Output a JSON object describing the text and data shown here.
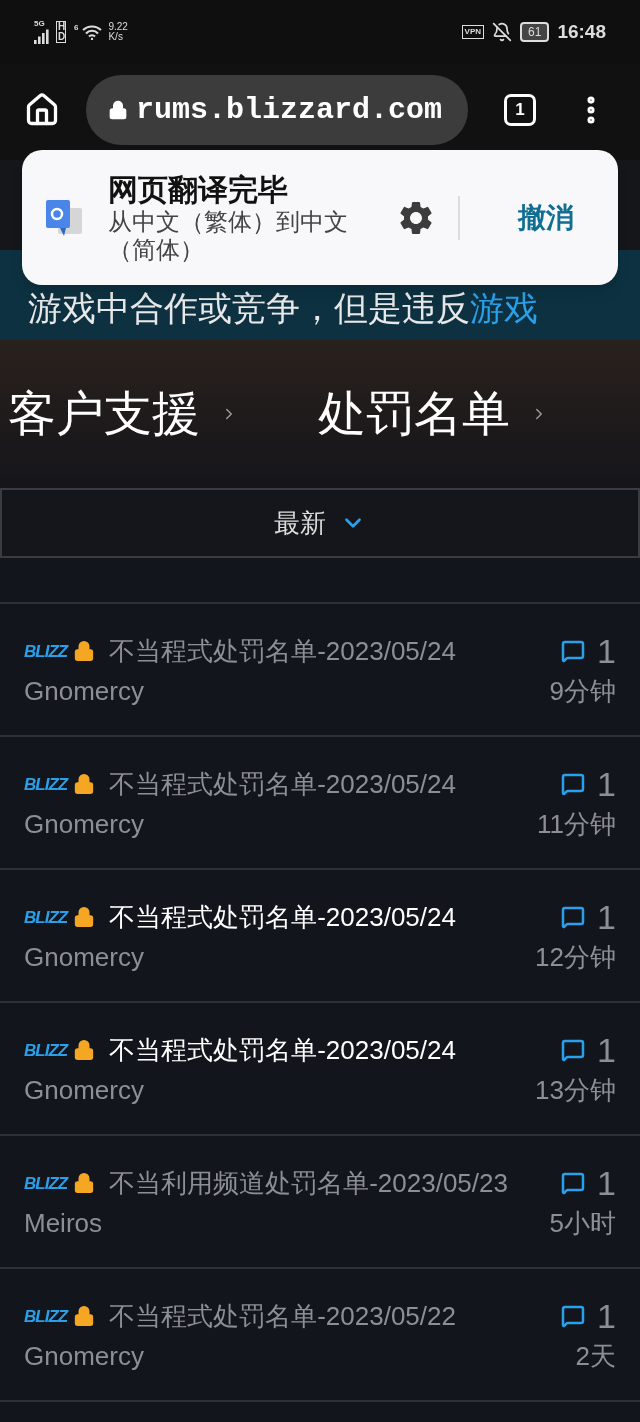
{
  "status_bar": {
    "network": "5G",
    "hd": "HD",
    "wifi_gen": "6",
    "speed": "9.22",
    "speed_unit": "K/s",
    "vpn": "VPN",
    "battery": "61",
    "time": "16:48"
  },
  "browser": {
    "url": "rums.blizzard.com",
    "tab_count": "1"
  },
  "translate_popup": {
    "title": "网页翻译完毕",
    "subtitle": "从中文（繁体）到中文（简体）",
    "undo": "撤消"
  },
  "banner": {
    "text": "游戏中合作或竞争，但是违反",
    "link": "游戏"
  },
  "breadcrumbs": [
    "客户支援",
    "处罚名单"
  ],
  "sort": {
    "label": "最新"
  },
  "topics": [
    {
      "badge": "BLIZZ",
      "title": "不当程式处罚名单-2023/05/24",
      "author": "Gnomercy",
      "replies": "1",
      "time": "9分钟",
      "visited": true
    },
    {
      "badge": "BLIZZ",
      "title": "不当程式处罚名单-2023/05/24",
      "author": "Gnomercy",
      "replies": "1",
      "time": "11分钟",
      "visited": true
    },
    {
      "badge": "BLIZZ",
      "title": "不当程式处罚名单-2023/05/24",
      "author": "Gnomercy",
      "replies": "1",
      "time": "12分钟",
      "visited": false
    },
    {
      "badge": "BLIZZ",
      "title": "不当程式处罚名单-2023/05/24",
      "author": "Gnomercy",
      "replies": "1",
      "time": "13分钟",
      "visited": false
    },
    {
      "badge": "BLIZZ",
      "title": "不当利用频道处罚名单-2023/05/23",
      "author": "Meiros",
      "replies": "1",
      "time": "5小时",
      "visited": true
    },
    {
      "badge": "BLIZZ",
      "title": "不当程式处罚名单-2023/05/22",
      "author": "Gnomercy",
      "replies": "1",
      "time": "2天",
      "visited": true
    }
  ]
}
